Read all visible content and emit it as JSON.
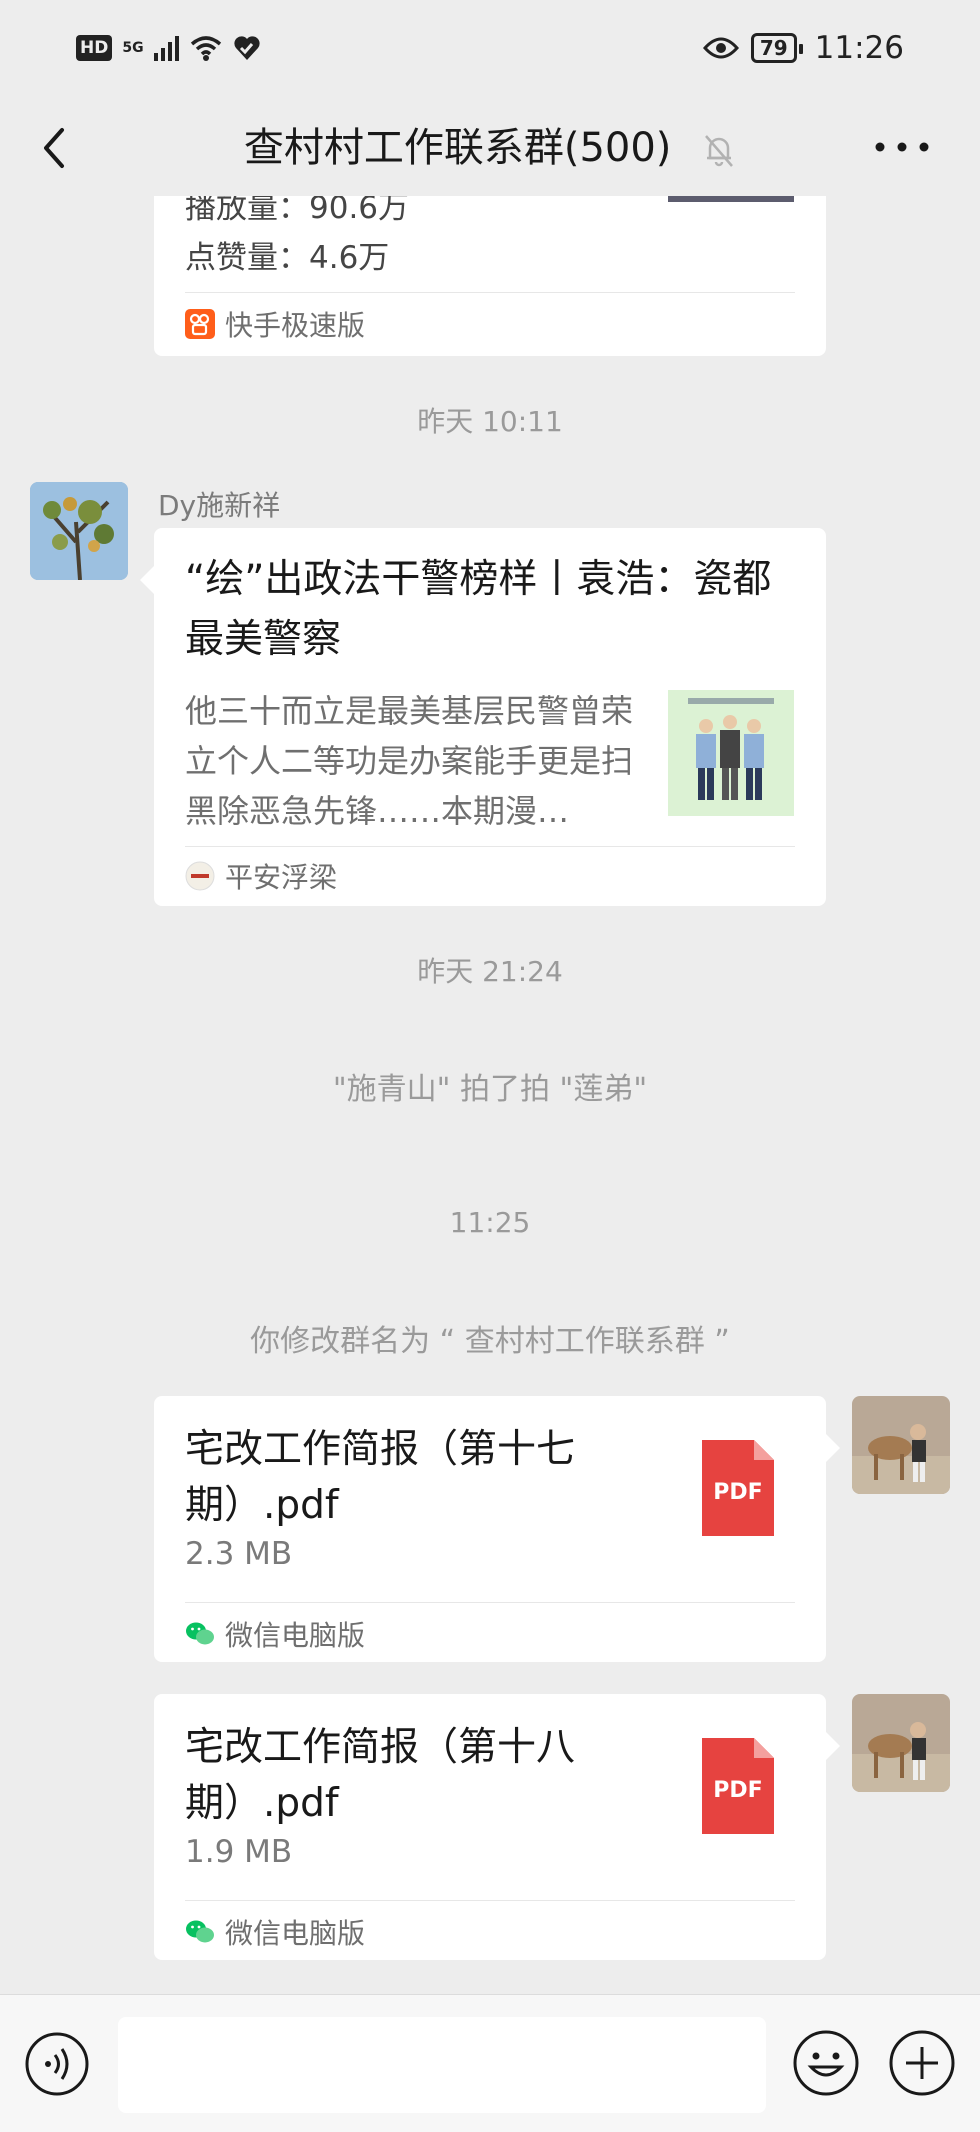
{
  "status_bar": {
    "hd": "HD",
    "network": "5G",
    "battery": "79",
    "time": "11:26"
  },
  "header": {
    "title": "查村村工作联系群(500)"
  },
  "messages": {
    "card1": {
      "play_count": "播放量：90.6万",
      "like_count": "点赞量：4.6万",
      "source": "快手极速版"
    },
    "time1": "昨天 10:11",
    "card2": {
      "sender": "Dy施新祥",
      "title": "“绘”出政法干警榜样丨袁浩：瓷都最美警察",
      "description": "他三十而立是最美基层民警曾荣立个人二等功是办案能手更是扫黑除恶急先锋……本期漫…",
      "source": "平安浮梁"
    },
    "time2": "昨天 21:24",
    "pat_notice": "\"施青山\" 拍了拍 \"莲弟\"",
    "time3": "11:25",
    "rename_notice": "你修改群名为 “ 查村村工作联系群 ”",
    "file1": {
      "name": "宅改工作简报（第十七期）.pdf",
      "size": "2.3 MB",
      "source": "微信电脑版",
      "icon_label": "PDF"
    },
    "file2": {
      "name": "宅改工作简报（第十八期）.pdf",
      "size": "1.9 MB",
      "source": "微信电脑版",
      "icon_label": "PDF"
    }
  },
  "colors": {
    "background": "#ededed",
    "pdf_red": "#e64340",
    "kuaishou_orange": "#ff5e1a",
    "wechat_green": "#07c160"
  }
}
